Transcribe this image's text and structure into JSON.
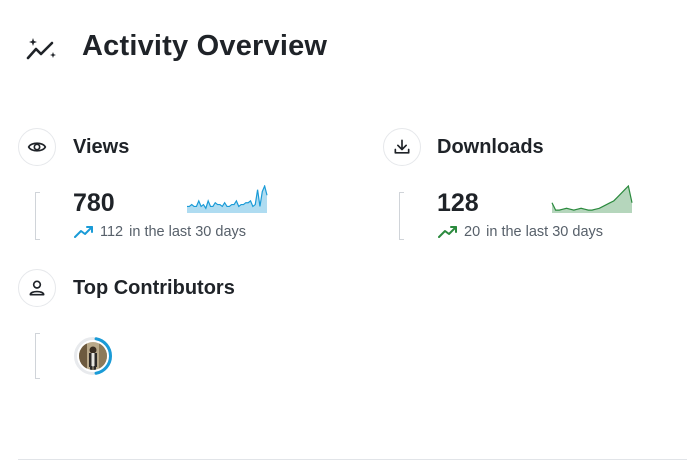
{
  "header": {
    "title": "Activity Overview",
    "icon": "activity-sparkle-icon"
  },
  "views": {
    "label": "Views",
    "icon": "eye-icon",
    "total": "780",
    "delta": "112",
    "period_text": "in the last 30 days",
    "trend_color": "#1a9bd7",
    "sparkline": [
      3,
      3,
      4,
      3,
      3,
      6,
      3,
      4,
      2,
      6,
      3,
      3,
      5,
      4,
      4,
      3,
      5,
      3,
      3,
      4,
      4,
      6,
      3,
      4,
      4,
      5,
      5,
      6,
      3,
      4,
      12,
      3,
      11,
      14,
      9
    ]
  },
  "downloads": {
    "label": "Downloads",
    "icon": "download-icon",
    "total": "128",
    "delta": "20",
    "period_text": "in the last 30 days",
    "trend_color": "#2b8a3e",
    "sparkline": [
      5,
      1,
      1,
      1.5,
      2,
      1.5,
      1,
      1.5,
      2,
      1.5,
      1,
      1,
      1.5,
      2,
      3,
      4,
      5,
      6,
      8,
      10,
      12,
      14,
      5
    ]
  },
  "contributors": {
    "label": "Top Contributors",
    "icon": "user-icon",
    "ring_color": "#1a9bd7"
  }
}
